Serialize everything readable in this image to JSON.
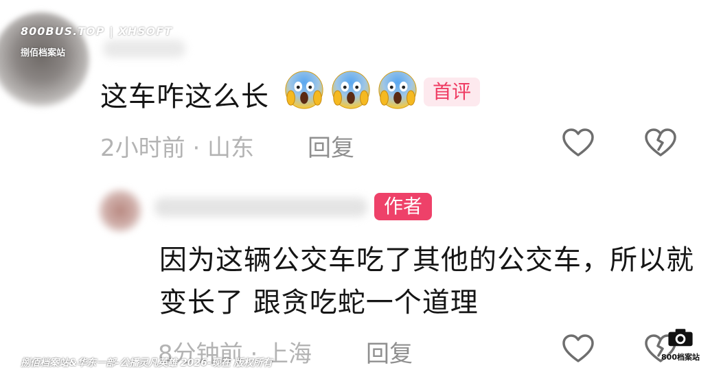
{
  "watermark": {
    "top": "800BUS.TOP | XHSOFT",
    "sub": "捌佰档案站",
    "bottom": "捌佰档案站&华东一部-公播灵凡英雄 2026-现在 版权所有",
    "logo_text": "800档案站"
  },
  "comments": [
    {
      "text": "这车咋这么长",
      "emojis": [
        "screaming-face",
        "screaming-face",
        "screaming-face"
      ],
      "badge": "首评",
      "meta": "2小时前 · 山东",
      "reply_label": "回复"
    },
    {
      "badge": "作者",
      "text": "因为这辆公交车吃了其他的公交车，所以就变长了 跟贪吃蛇一个道理",
      "meta": "8分钟前 · 上海",
      "reply_label": "回复"
    }
  ],
  "icons": {
    "like": "heart-outline-icon",
    "dislike": "broken-heart-icon"
  },
  "colors": {
    "first_badge_bg": "#fde9ee",
    "first_badge_fg": "#ef3b62",
    "author_badge_bg": "#ee4169",
    "author_badge_fg": "#ffffff",
    "meta_text": "#b3b3b3"
  }
}
